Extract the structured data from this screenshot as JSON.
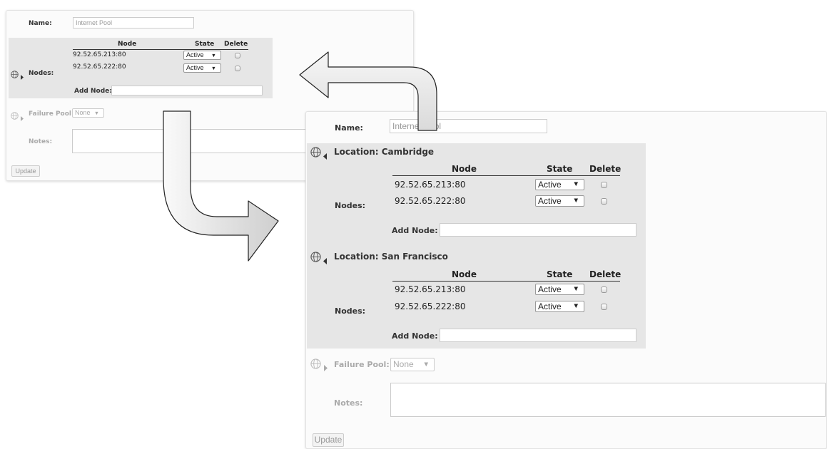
{
  "small": {
    "name_label": "Name:",
    "name_value": "Internet Pool",
    "table_headers": [
      "Node",
      "State",
      "Delete"
    ],
    "nodes_label": "Nodes:",
    "rows": [
      {
        "node": "92.52.65.213:80",
        "state": "Active"
      },
      {
        "node": "92.52.65.222:80",
        "state": "Active"
      }
    ],
    "add_node_label": "Add Node:",
    "failure_pool_label": "Failure Pool:",
    "failure_pool_value": "None",
    "notes_label": "Notes:",
    "update_button": "Update"
  },
  "large": {
    "name_label": "Name:",
    "name_value": "Internet Pool",
    "locations": [
      {
        "title": "Location: Cambridge",
        "table_headers": [
          "Node",
          "State",
          "Delete"
        ],
        "nodes_label": "Nodes:",
        "rows": [
          {
            "node": "92.52.65.213:80",
            "state": "Active"
          },
          {
            "node": "92.52.65.222:80",
            "state": "Active"
          }
        ],
        "add_node_label": "Add Node:"
      },
      {
        "title": "Location: San Francisco",
        "table_headers": [
          "Node",
          "State",
          "Delete"
        ],
        "nodes_label": "Nodes:",
        "rows": [
          {
            "node": "92.52.65.213:80",
            "state": "Active"
          },
          {
            "node": "92.52.65.222:80",
            "state": "Active"
          }
        ],
        "add_node_label": "Add Node:"
      }
    ],
    "failure_pool_label": "Failure Pool:",
    "failure_pool_value": "None",
    "notes_label": "Notes:",
    "update_button": "Update"
  },
  "colors": {
    "panel_bg": "#fbfbfb",
    "section_bg": "#e6e6e6",
    "arrow_fill": "#f2f2f2",
    "arrow_stroke": "#222222"
  },
  "icons": [
    "globe-icon",
    "triangle-right-icon",
    "triangle-left-icon",
    "dropdown-arrow-icon",
    "curved-arrow-left",
    "curved-arrow-right"
  ]
}
